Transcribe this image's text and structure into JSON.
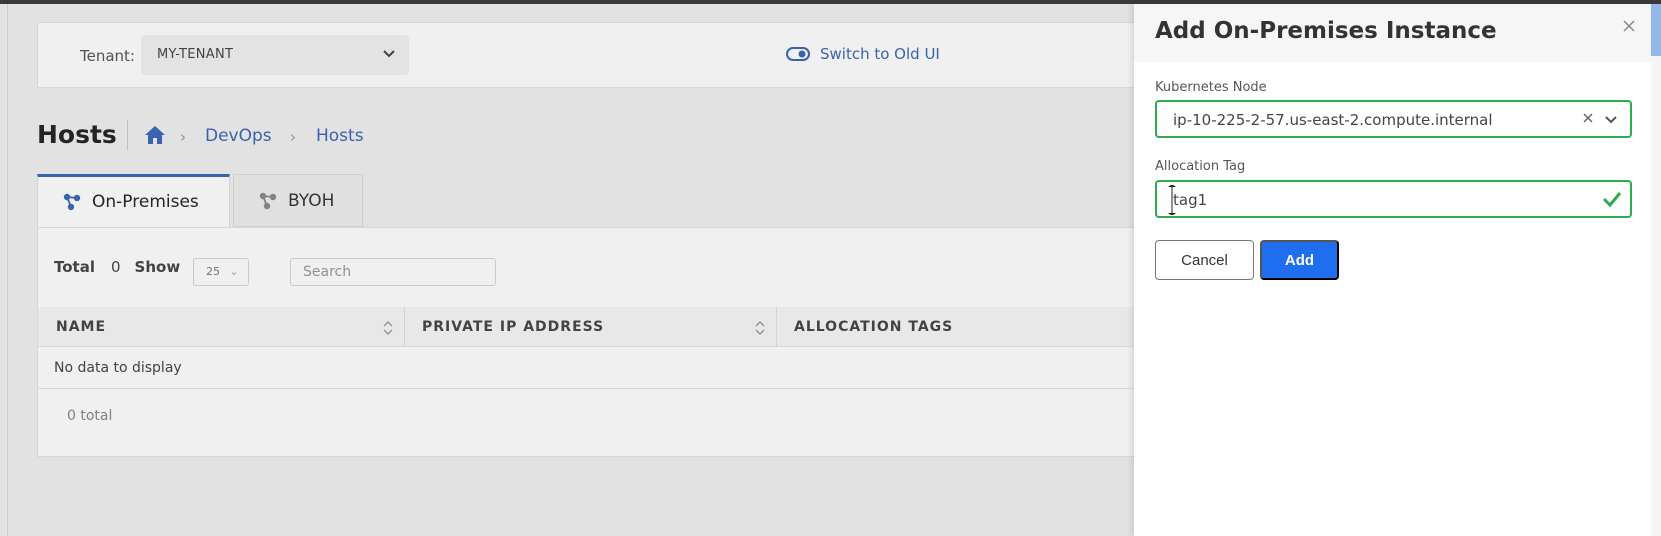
{
  "header": {
    "tenant_label": "Tenant:",
    "tenant_value": "MY-TENANT",
    "switch_label": "Switch to Old UI"
  },
  "page": {
    "title": "Hosts",
    "breadcrumb": [
      "DevOps",
      "Hosts"
    ]
  },
  "tabs": [
    {
      "label": "On-Premises",
      "active": true
    },
    {
      "label": "BYOH",
      "active": false
    }
  ],
  "list": {
    "total_label": "Total",
    "total_value": "0",
    "show_label": "Show",
    "page_size": "25",
    "search_placeholder": "Search",
    "columns": [
      "NAME",
      "PRIVATE IP ADDRESS",
      "ALLOCATION TAGS"
    ],
    "empty_text": "No data to display",
    "footer_total": "0 total"
  },
  "drawer": {
    "title": "Add On-Premises Instance",
    "node_label": "Kubernetes Node",
    "node_value": "ip-10-225-2-57.us-east-2.compute.internal",
    "tag_label": "Allocation Tag",
    "tag_value": "tag1",
    "cancel_label": "Cancel",
    "add_label": "Add"
  },
  "colors": {
    "accent": "#3a66b8",
    "primary_button": "#1f6ef0",
    "valid_border": "#2eaa4f"
  }
}
